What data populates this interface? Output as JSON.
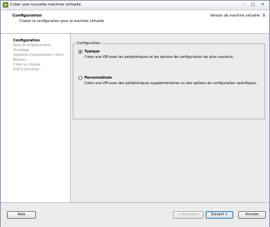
{
  "window": {
    "title": "Créer une nouvelle machine virtuelle",
    "controls": {
      "minimize": "–",
      "maximize": "□",
      "close": "✕"
    }
  },
  "header": {
    "title": "Configuration",
    "subtitle": "Choisir la configuration pour la machine virtuelle",
    "version": "Version de machine virtuelle : 8"
  },
  "sidebar": {
    "steps": [
      {
        "label": "Configuration",
        "active": true
      },
      {
        "label": "Nom et emplacement",
        "active": false
      },
      {
        "label": "Stockage",
        "active": false
      },
      {
        "label": "Système d'exploitation client",
        "active": false
      },
      {
        "label": "Réseau",
        "active": false
      },
      {
        "label": "Créer un disque",
        "active": false
      },
      {
        "label": "Prêt à terminer",
        "active": false
      }
    ]
  },
  "main": {
    "group_title": "Configuration",
    "options": [
      {
        "label": "Typique",
        "description": "Créer une VM avec les périphériques et les options de configuration les plus courants.",
        "selected": true
      },
      {
        "label": "Personnalisée",
        "description": "Créer une VM avec des périphériques supplémentaires ou des options de configuration spécifiques.",
        "selected": false
      }
    ]
  },
  "footer": {
    "help": "Aide",
    "back": "< Précédent",
    "next": "Suivant >",
    "cancel": "Annuler"
  },
  "colors": {
    "accent": "#3c7fb1",
    "panel": "#ececec",
    "icon": "#7aa43a"
  }
}
